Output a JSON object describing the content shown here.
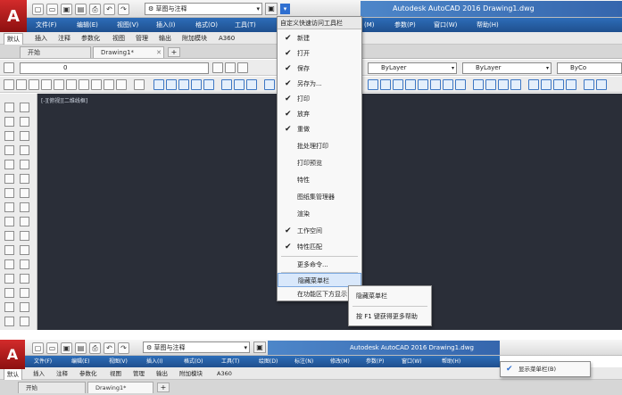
{
  "top": {
    "logo_letter": "A",
    "workspace": "草图与注释",
    "app_title": "Autodesk AutoCAD 2016    Drawing1.dwg",
    "menu": [
      "文件(F)",
      "编辑(E)",
      "视图(V)",
      "插入(I)",
      "格式(O)",
      "工具(T)",
      "(M)",
      "参数(P)",
      "窗口(W)",
      "帮助(H)"
    ],
    "ribbon_tabs": [
      "默认",
      "插入",
      "注释",
      "参数化",
      "视图",
      "管理",
      "输出",
      "附加模块",
      "A360"
    ],
    "doc_tabs": {
      "start": "开始",
      "drawing": "Drawing1*",
      "add": "+"
    },
    "layer_value": "0",
    "bylayer": "ByLayer",
    "bycolor": "ByCo",
    "view_label": "[-][俯视][二维线框]"
  },
  "dropdown": {
    "header": "自定义快速访问工具栏",
    "items": [
      {
        "label": "新建",
        "checked": true
      },
      {
        "label": "打开",
        "checked": true
      },
      {
        "label": "保存",
        "checked": true
      },
      {
        "label": "另存为...",
        "checked": true
      },
      {
        "label": "打印",
        "checked": true
      },
      {
        "label": "放弃",
        "checked": true
      },
      {
        "label": "重做",
        "checked": true
      },
      {
        "label": "批处理打印",
        "checked": false
      },
      {
        "label": "打印预览",
        "checked": false
      },
      {
        "label": "特性",
        "checked": false
      },
      {
        "label": "图纸集管理器",
        "checked": false
      },
      {
        "label": "渲染",
        "checked": false
      },
      {
        "label": "工作空间",
        "checked": true
      },
      {
        "label": "特性匹配",
        "checked": true
      }
    ],
    "more_commands": "更多命令...",
    "hide_menubar": "隐藏菜单栏",
    "show_below_ribbon": "在功能区下方显示",
    "check_mark": "✔"
  },
  "submenu": {
    "hide_menubar": "隐藏菜单栏",
    "help": "按 F1 键获得更多帮助"
  },
  "bottom": {
    "logo_letter": "A",
    "workspace": "草图与注释",
    "app_title": "Autodesk AutoCAD 2016    Drawing1.dwg",
    "menu": [
      "文件(F)",
      "编辑(E)",
      "视图(V)",
      "插入(I)",
      "格式(O)",
      "工具(T)",
      "绘图(D)",
      "标注(N)",
      "修改(M)",
      "参数(P)",
      "窗口(W)",
      "帮助(H)"
    ],
    "ribbon_tabs": [
      "默认",
      "插入",
      "注释",
      "参数化",
      "视图",
      "管理",
      "输出",
      "附加模块",
      "A360"
    ],
    "doc_tabs": {
      "start": "开始",
      "drawing": "Drawing1*",
      "add": "+"
    },
    "context_item": "显示菜单栏(B)",
    "check_mark": "✔"
  }
}
